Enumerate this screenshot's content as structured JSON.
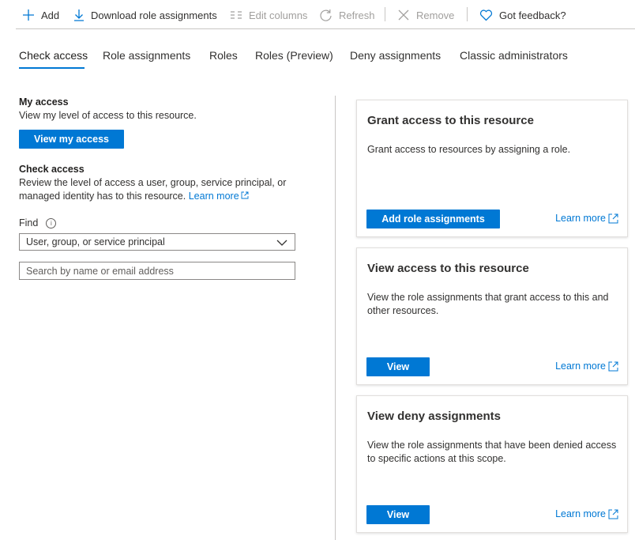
{
  "toolbar": {
    "add": "Add",
    "download": "Download role assignments",
    "edit_columns": "Edit columns",
    "refresh": "Refresh",
    "remove": "Remove",
    "feedback": "Got feedback?"
  },
  "tabs": [
    {
      "label": "Check access",
      "active": true
    },
    {
      "label": "Role assignments"
    },
    {
      "label": "Roles"
    },
    {
      "label": "Roles (Preview)"
    },
    {
      "label": "Deny assignments"
    },
    {
      "label": "Classic administrators"
    }
  ],
  "my_access": {
    "title": "My access",
    "description": "View my level of access to this resource.",
    "button": "View my access"
  },
  "check_access": {
    "title": "Check access",
    "description_line1": "Review the level of access a user, group, service principal, or",
    "description_line2": "managed identity has to this resource.",
    "learn_more": "Learn more",
    "find_label": "Find",
    "select_value": "User, group, or service principal",
    "search_placeholder": "Search by name or email address"
  },
  "cards": [
    {
      "title": "Grant access to this resource",
      "description": "Grant access to resources by assigning a role.",
      "button": "Add role assignments",
      "learn_more": "Learn more"
    },
    {
      "title": "View access to this resource",
      "description": "View the role assignments that grant access to this and other resources.",
      "button": "View",
      "learn_more": "Learn more"
    },
    {
      "title": "View deny assignments",
      "description": "View the role assignments that have been denied access to specific actions at this scope.",
      "button": "View",
      "learn_more": "Learn more"
    }
  ],
  "colors": {
    "accent": "#0078d4",
    "text": "#323130",
    "disabled": "#a19f9d"
  }
}
